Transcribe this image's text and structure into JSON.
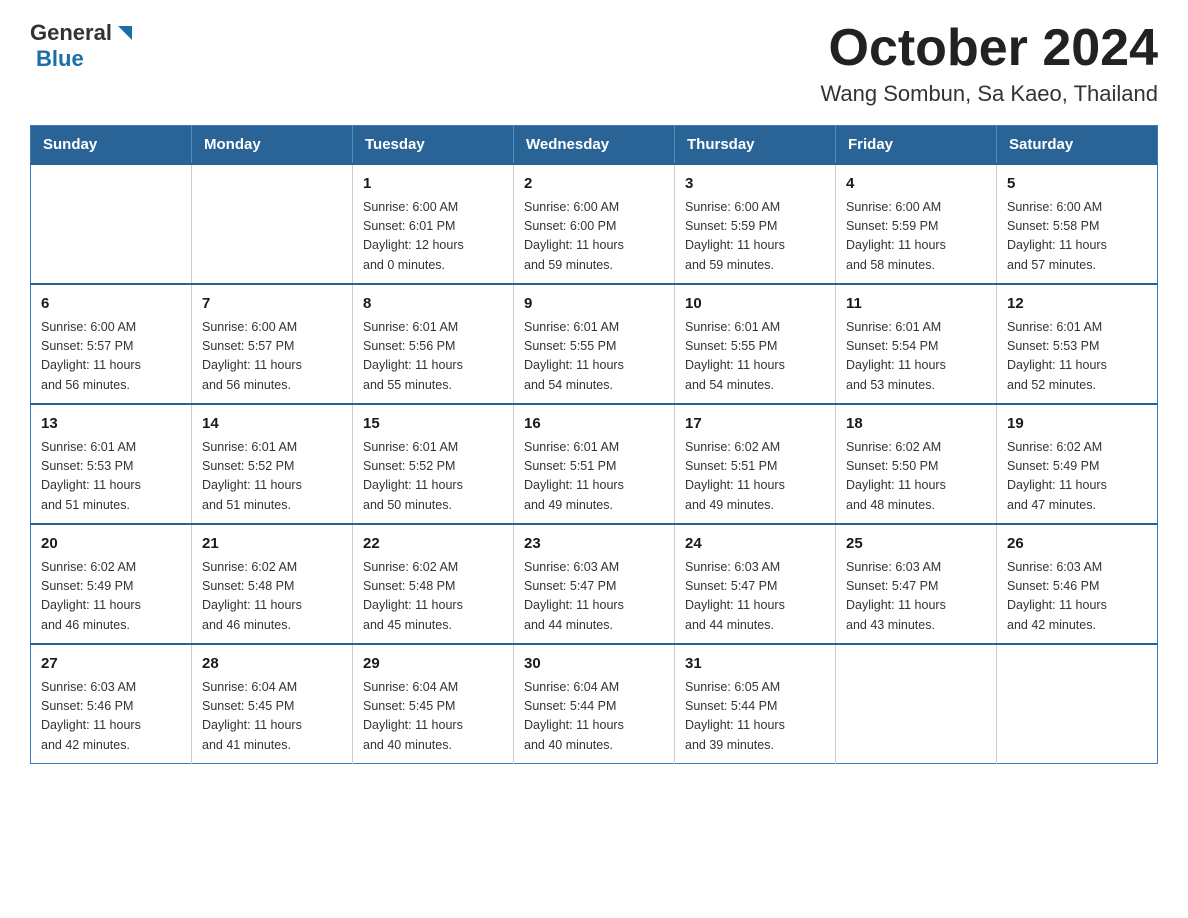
{
  "logo": {
    "general": "General",
    "triangle": "▶",
    "blue": "Blue"
  },
  "title": "October 2024",
  "subtitle": "Wang Sombun, Sa Kaeo, Thailand",
  "days_of_week": [
    "Sunday",
    "Monday",
    "Tuesday",
    "Wednesday",
    "Thursday",
    "Friday",
    "Saturday"
  ],
  "weeks": [
    [
      {
        "day": "",
        "info": ""
      },
      {
        "day": "",
        "info": ""
      },
      {
        "day": "1",
        "info": "Sunrise: 6:00 AM\nSunset: 6:01 PM\nDaylight: 12 hours\nand 0 minutes."
      },
      {
        "day": "2",
        "info": "Sunrise: 6:00 AM\nSunset: 6:00 PM\nDaylight: 11 hours\nand 59 minutes."
      },
      {
        "day": "3",
        "info": "Sunrise: 6:00 AM\nSunset: 5:59 PM\nDaylight: 11 hours\nand 59 minutes."
      },
      {
        "day": "4",
        "info": "Sunrise: 6:00 AM\nSunset: 5:59 PM\nDaylight: 11 hours\nand 58 minutes."
      },
      {
        "day": "5",
        "info": "Sunrise: 6:00 AM\nSunset: 5:58 PM\nDaylight: 11 hours\nand 57 minutes."
      }
    ],
    [
      {
        "day": "6",
        "info": "Sunrise: 6:00 AM\nSunset: 5:57 PM\nDaylight: 11 hours\nand 56 minutes."
      },
      {
        "day": "7",
        "info": "Sunrise: 6:00 AM\nSunset: 5:57 PM\nDaylight: 11 hours\nand 56 minutes."
      },
      {
        "day": "8",
        "info": "Sunrise: 6:01 AM\nSunset: 5:56 PM\nDaylight: 11 hours\nand 55 minutes."
      },
      {
        "day": "9",
        "info": "Sunrise: 6:01 AM\nSunset: 5:55 PM\nDaylight: 11 hours\nand 54 minutes."
      },
      {
        "day": "10",
        "info": "Sunrise: 6:01 AM\nSunset: 5:55 PM\nDaylight: 11 hours\nand 54 minutes."
      },
      {
        "day": "11",
        "info": "Sunrise: 6:01 AM\nSunset: 5:54 PM\nDaylight: 11 hours\nand 53 minutes."
      },
      {
        "day": "12",
        "info": "Sunrise: 6:01 AM\nSunset: 5:53 PM\nDaylight: 11 hours\nand 52 minutes."
      }
    ],
    [
      {
        "day": "13",
        "info": "Sunrise: 6:01 AM\nSunset: 5:53 PM\nDaylight: 11 hours\nand 51 minutes."
      },
      {
        "day": "14",
        "info": "Sunrise: 6:01 AM\nSunset: 5:52 PM\nDaylight: 11 hours\nand 51 minutes."
      },
      {
        "day": "15",
        "info": "Sunrise: 6:01 AM\nSunset: 5:52 PM\nDaylight: 11 hours\nand 50 minutes."
      },
      {
        "day": "16",
        "info": "Sunrise: 6:01 AM\nSunset: 5:51 PM\nDaylight: 11 hours\nand 49 minutes."
      },
      {
        "day": "17",
        "info": "Sunrise: 6:02 AM\nSunset: 5:51 PM\nDaylight: 11 hours\nand 49 minutes."
      },
      {
        "day": "18",
        "info": "Sunrise: 6:02 AM\nSunset: 5:50 PM\nDaylight: 11 hours\nand 48 minutes."
      },
      {
        "day": "19",
        "info": "Sunrise: 6:02 AM\nSunset: 5:49 PM\nDaylight: 11 hours\nand 47 minutes."
      }
    ],
    [
      {
        "day": "20",
        "info": "Sunrise: 6:02 AM\nSunset: 5:49 PM\nDaylight: 11 hours\nand 46 minutes."
      },
      {
        "day": "21",
        "info": "Sunrise: 6:02 AM\nSunset: 5:48 PM\nDaylight: 11 hours\nand 46 minutes."
      },
      {
        "day": "22",
        "info": "Sunrise: 6:02 AM\nSunset: 5:48 PM\nDaylight: 11 hours\nand 45 minutes."
      },
      {
        "day": "23",
        "info": "Sunrise: 6:03 AM\nSunset: 5:47 PM\nDaylight: 11 hours\nand 44 minutes."
      },
      {
        "day": "24",
        "info": "Sunrise: 6:03 AM\nSunset: 5:47 PM\nDaylight: 11 hours\nand 44 minutes."
      },
      {
        "day": "25",
        "info": "Sunrise: 6:03 AM\nSunset: 5:47 PM\nDaylight: 11 hours\nand 43 minutes."
      },
      {
        "day": "26",
        "info": "Sunrise: 6:03 AM\nSunset: 5:46 PM\nDaylight: 11 hours\nand 42 minutes."
      }
    ],
    [
      {
        "day": "27",
        "info": "Sunrise: 6:03 AM\nSunset: 5:46 PM\nDaylight: 11 hours\nand 42 minutes."
      },
      {
        "day": "28",
        "info": "Sunrise: 6:04 AM\nSunset: 5:45 PM\nDaylight: 11 hours\nand 41 minutes."
      },
      {
        "day": "29",
        "info": "Sunrise: 6:04 AM\nSunset: 5:45 PM\nDaylight: 11 hours\nand 40 minutes."
      },
      {
        "day": "30",
        "info": "Sunrise: 6:04 AM\nSunset: 5:44 PM\nDaylight: 11 hours\nand 40 minutes."
      },
      {
        "day": "31",
        "info": "Sunrise: 6:05 AM\nSunset: 5:44 PM\nDaylight: 11 hours\nand 39 minutes."
      },
      {
        "day": "",
        "info": ""
      },
      {
        "day": "",
        "info": ""
      }
    ]
  ]
}
